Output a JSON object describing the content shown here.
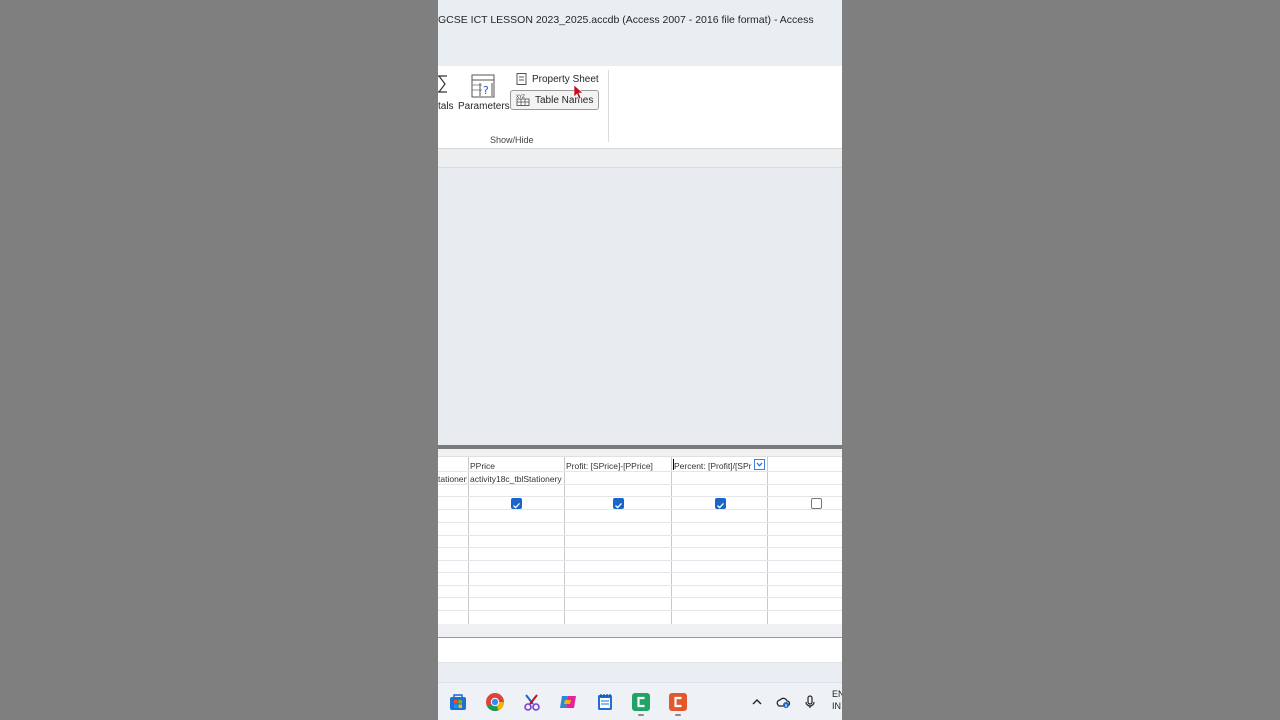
{
  "window": {
    "title": "GCSE ICT LESSON 2023_2025.accdb (Access 2007 - 2016 file format)  -  Access"
  },
  "ribbon": {
    "totals_label": "tals",
    "parameters_label": "Parameters",
    "property_sheet_label": "Property Sheet",
    "table_names_label": "Table Names",
    "group_label": "Show/Hide"
  },
  "grid": {
    "columns": [
      {
        "field": "",
        "table": "tationery",
        "show": null
      },
      {
        "field": "PPrice",
        "table": "activity18c_tblStationery",
        "show": true
      },
      {
        "field": "Profit: [SPrice]-[PPrice]",
        "table": "",
        "show": true
      },
      {
        "field": "Percent: [Profit]/[SPr",
        "table": "",
        "show": true
      },
      {
        "field": "",
        "table": "",
        "show": false
      }
    ]
  },
  "taskbar": {
    "language_line1": "EN",
    "language_line2": "IN"
  },
  "colors": {
    "accent": "#1a65c9",
    "cursor": "#c50f1f",
    "excel_like_green": "#21a366",
    "orange_app": "#e2572c"
  }
}
